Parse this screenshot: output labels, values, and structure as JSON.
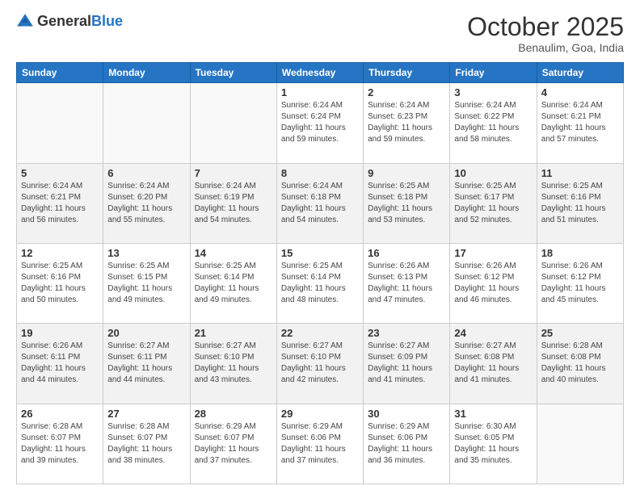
{
  "logo": {
    "general": "General",
    "blue": "Blue"
  },
  "header": {
    "month": "October 2025",
    "location": "Benaulim, Goa, India"
  },
  "weekdays": [
    "Sunday",
    "Monday",
    "Tuesday",
    "Wednesday",
    "Thursday",
    "Friday",
    "Saturday"
  ],
  "weeks": [
    [
      {
        "day": "",
        "info": ""
      },
      {
        "day": "",
        "info": ""
      },
      {
        "day": "",
        "info": ""
      },
      {
        "day": "1",
        "info": "Sunrise: 6:24 AM\nSunset: 6:24 PM\nDaylight: 11 hours\nand 59 minutes."
      },
      {
        "day": "2",
        "info": "Sunrise: 6:24 AM\nSunset: 6:23 PM\nDaylight: 11 hours\nand 59 minutes."
      },
      {
        "day": "3",
        "info": "Sunrise: 6:24 AM\nSunset: 6:22 PM\nDaylight: 11 hours\nand 58 minutes."
      },
      {
        "day": "4",
        "info": "Sunrise: 6:24 AM\nSunset: 6:21 PM\nDaylight: 11 hours\nand 57 minutes."
      }
    ],
    [
      {
        "day": "5",
        "info": "Sunrise: 6:24 AM\nSunset: 6:21 PM\nDaylight: 11 hours\nand 56 minutes."
      },
      {
        "day": "6",
        "info": "Sunrise: 6:24 AM\nSunset: 6:20 PM\nDaylight: 11 hours\nand 55 minutes."
      },
      {
        "day": "7",
        "info": "Sunrise: 6:24 AM\nSunset: 6:19 PM\nDaylight: 11 hours\nand 54 minutes."
      },
      {
        "day": "8",
        "info": "Sunrise: 6:24 AM\nSunset: 6:18 PM\nDaylight: 11 hours\nand 54 minutes."
      },
      {
        "day": "9",
        "info": "Sunrise: 6:25 AM\nSunset: 6:18 PM\nDaylight: 11 hours\nand 53 minutes."
      },
      {
        "day": "10",
        "info": "Sunrise: 6:25 AM\nSunset: 6:17 PM\nDaylight: 11 hours\nand 52 minutes."
      },
      {
        "day": "11",
        "info": "Sunrise: 6:25 AM\nSunset: 6:16 PM\nDaylight: 11 hours\nand 51 minutes."
      }
    ],
    [
      {
        "day": "12",
        "info": "Sunrise: 6:25 AM\nSunset: 6:16 PM\nDaylight: 11 hours\nand 50 minutes."
      },
      {
        "day": "13",
        "info": "Sunrise: 6:25 AM\nSunset: 6:15 PM\nDaylight: 11 hours\nand 49 minutes."
      },
      {
        "day": "14",
        "info": "Sunrise: 6:25 AM\nSunset: 6:14 PM\nDaylight: 11 hours\nand 49 minutes."
      },
      {
        "day": "15",
        "info": "Sunrise: 6:25 AM\nSunset: 6:14 PM\nDaylight: 11 hours\nand 48 minutes."
      },
      {
        "day": "16",
        "info": "Sunrise: 6:26 AM\nSunset: 6:13 PM\nDaylight: 11 hours\nand 47 minutes."
      },
      {
        "day": "17",
        "info": "Sunrise: 6:26 AM\nSunset: 6:12 PM\nDaylight: 11 hours\nand 46 minutes."
      },
      {
        "day": "18",
        "info": "Sunrise: 6:26 AM\nSunset: 6:12 PM\nDaylight: 11 hours\nand 45 minutes."
      }
    ],
    [
      {
        "day": "19",
        "info": "Sunrise: 6:26 AM\nSunset: 6:11 PM\nDaylight: 11 hours\nand 44 minutes."
      },
      {
        "day": "20",
        "info": "Sunrise: 6:27 AM\nSunset: 6:11 PM\nDaylight: 11 hours\nand 44 minutes."
      },
      {
        "day": "21",
        "info": "Sunrise: 6:27 AM\nSunset: 6:10 PM\nDaylight: 11 hours\nand 43 minutes."
      },
      {
        "day": "22",
        "info": "Sunrise: 6:27 AM\nSunset: 6:10 PM\nDaylight: 11 hours\nand 42 minutes."
      },
      {
        "day": "23",
        "info": "Sunrise: 6:27 AM\nSunset: 6:09 PM\nDaylight: 11 hours\nand 41 minutes."
      },
      {
        "day": "24",
        "info": "Sunrise: 6:27 AM\nSunset: 6:08 PM\nDaylight: 11 hours\nand 41 minutes."
      },
      {
        "day": "25",
        "info": "Sunrise: 6:28 AM\nSunset: 6:08 PM\nDaylight: 11 hours\nand 40 minutes."
      }
    ],
    [
      {
        "day": "26",
        "info": "Sunrise: 6:28 AM\nSunset: 6:07 PM\nDaylight: 11 hours\nand 39 minutes."
      },
      {
        "day": "27",
        "info": "Sunrise: 6:28 AM\nSunset: 6:07 PM\nDaylight: 11 hours\nand 38 minutes."
      },
      {
        "day": "28",
        "info": "Sunrise: 6:29 AM\nSunset: 6:07 PM\nDaylight: 11 hours\nand 37 minutes."
      },
      {
        "day": "29",
        "info": "Sunrise: 6:29 AM\nSunset: 6:06 PM\nDaylight: 11 hours\nand 37 minutes."
      },
      {
        "day": "30",
        "info": "Sunrise: 6:29 AM\nSunset: 6:06 PM\nDaylight: 11 hours\nand 36 minutes."
      },
      {
        "day": "31",
        "info": "Sunrise: 6:30 AM\nSunset: 6:05 PM\nDaylight: 11 hours\nand 35 minutes."
      },
      {
        "day": "",
        "info": ""
      }
    ]
  ]
}
